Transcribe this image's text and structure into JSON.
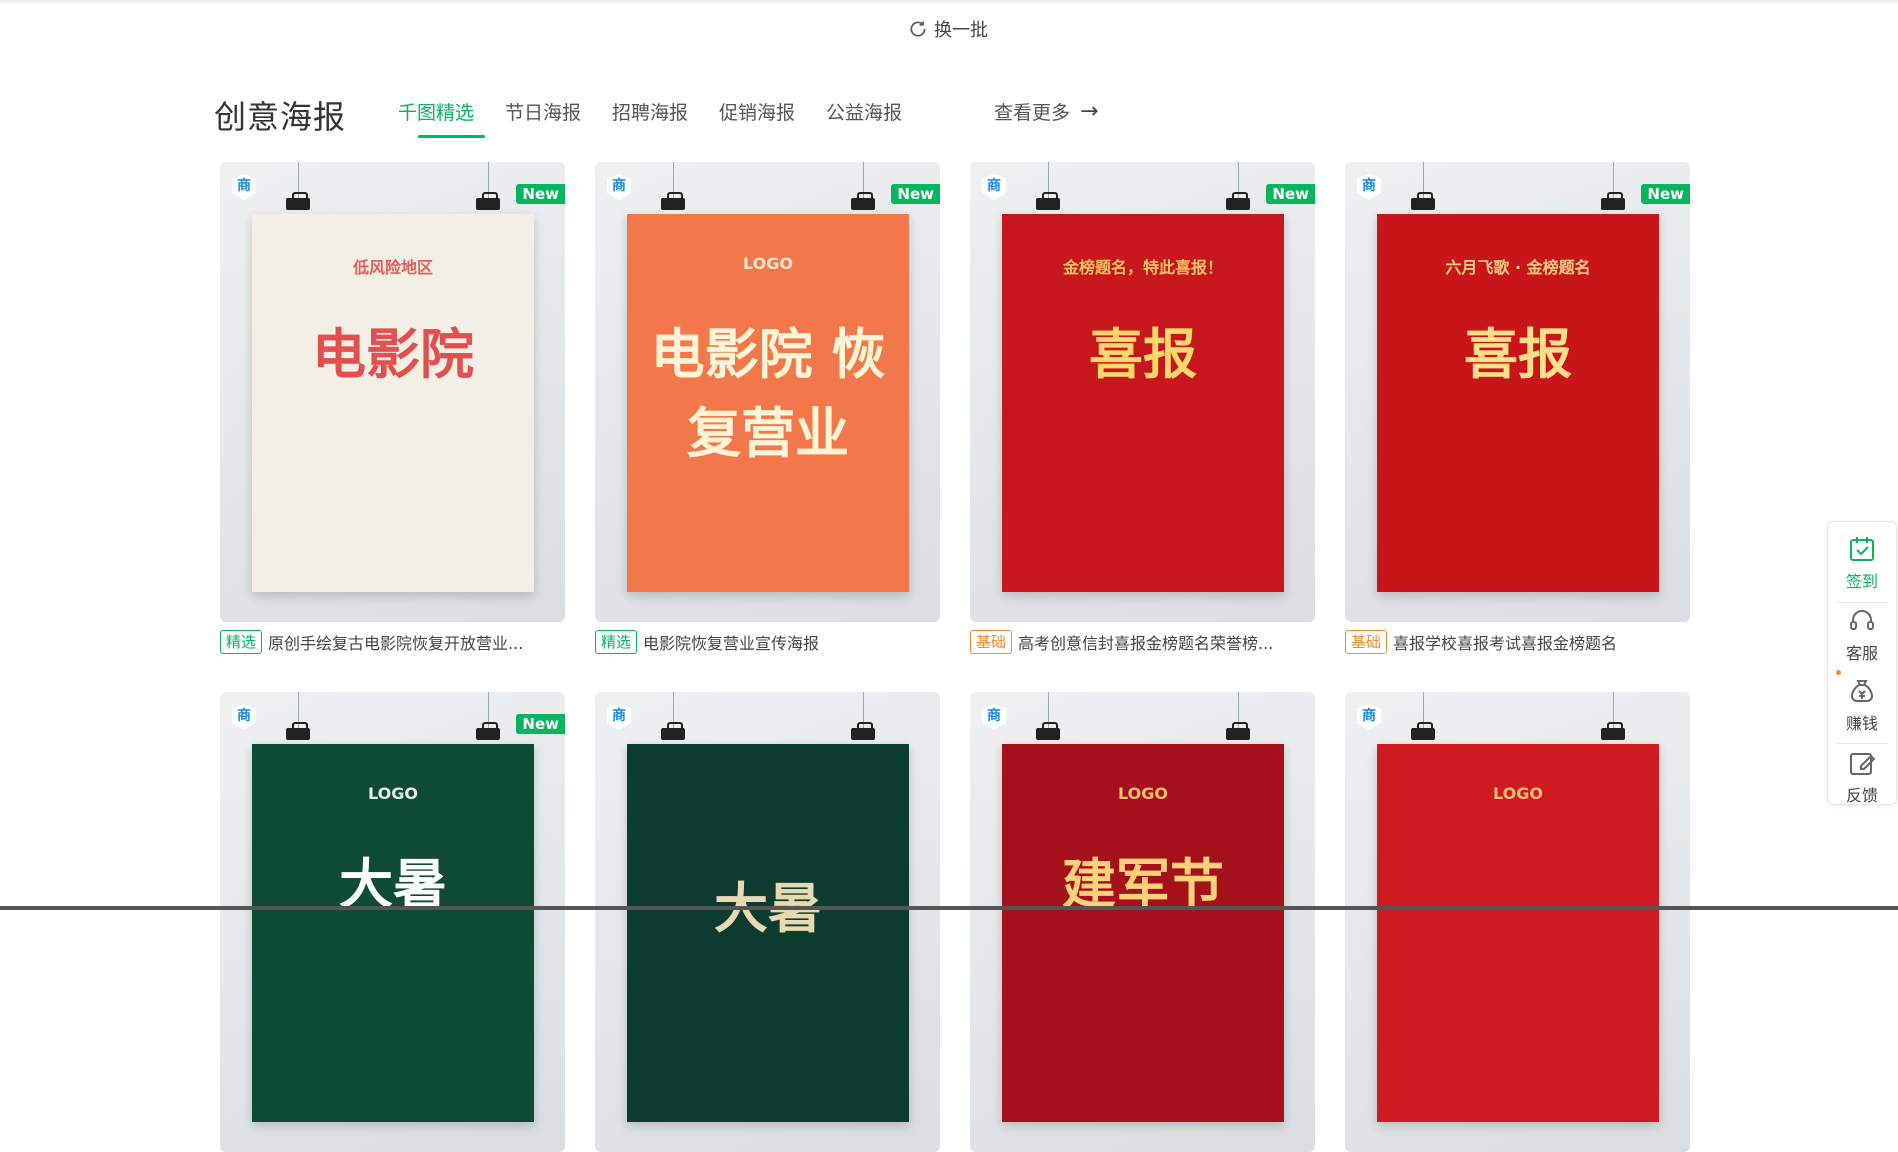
{
  "refresh": {
    "label": "换一批"
  },
  "section": {
    "title": "创意海报",
    "tabs": [
      "千图精选",
      "节日海报",
      "招聘海报",
      "促销海报",
      "公益海报"
    ],
    "active_tab": 0,
    "more_label": "查看更多"
  },
  "badges": {
    "commercial": "商",
    "new": "New"
  },
  "cards": [
    {
      "tag": "精选",
      "tag_color": "green",
      "title": "原创手绘复古电影院恢复开放营业...",
      "is_new": true,
      "poster_text": "电影院",
      "poster_sub": "低风险地区",
      "poster_bg": "#f3efe4",
      "poster_fg": "#e24f4f"
    },
    {
      "tag": "精选",
      "tag_color": "green",
      "title": "电影院恢复营业宣传海报",
      "is_new": true,
      "poster_text": "电影院 恢复营业",
      "poster_sub": "LOGO",
      "poster_bg": "#f2784b",
      "poster_fg": "#fff4d6"
    },
    {
      "tag": "基础",
      "tag_color": "orange",
      "title": "高考创意信封喜报金榜题名荣誉榜...",
      "is_new": true,
      "poster_text": "喜报",
      "poster_sub": "金榜题名，特此喜报！",
      "poster_bg": "#c8161d",
      "poster_fg": "#ffd86b"
    },
    {
      "tag": "基础",
      "tag_color": "orange",
      "title": "喜报学校喜报考试喜报金榜题名",
      "is_new": true,
      "poster_text": "喜报",
      "poster_sub": "六月飞歌 · 金榜题名",
      "poster_bg": "#c9141a",
      "poster_fg": "#ffe08a"
    },
    {
      "is_new": true,
      "poster_text": "大暑",
      "poster_sub": "LOGO",
      "poster_bg": "#0e4a34",
      "poster_fg": "#ffffff"
    },
    {
      "is_new": false,
      "poster_text": "大暑",
      "poster_sub": "",
      "poster_bg": "#0c3b30",
      "poster_fg": "#e8d9b0"
    },
    {
      "is_new": false,
      "poster_text": "建军节",
      "poster_sub": "LOGO",
      "poster_bg": "#a5111a",
      "poster_fg": "#ffd27a"
    },
    {
      "is_new": false,
      "poster_text": "",
      "poster_sub": "LOGO",
      "poster_bg": "#d01a22",
      "poster_fg": "#ffd27a"
    }
  ],
  "sidebar": {
    "checkin": "签到",
    "service": "客服",
    "earn": "赚钱",
    "feedback": "反馈"
  },
  "colors": {
    "accent": "#07b55c",
    "basic_tag": "#f08c2c",
    "commercial_badge": "#1a89e3"
  }
}
